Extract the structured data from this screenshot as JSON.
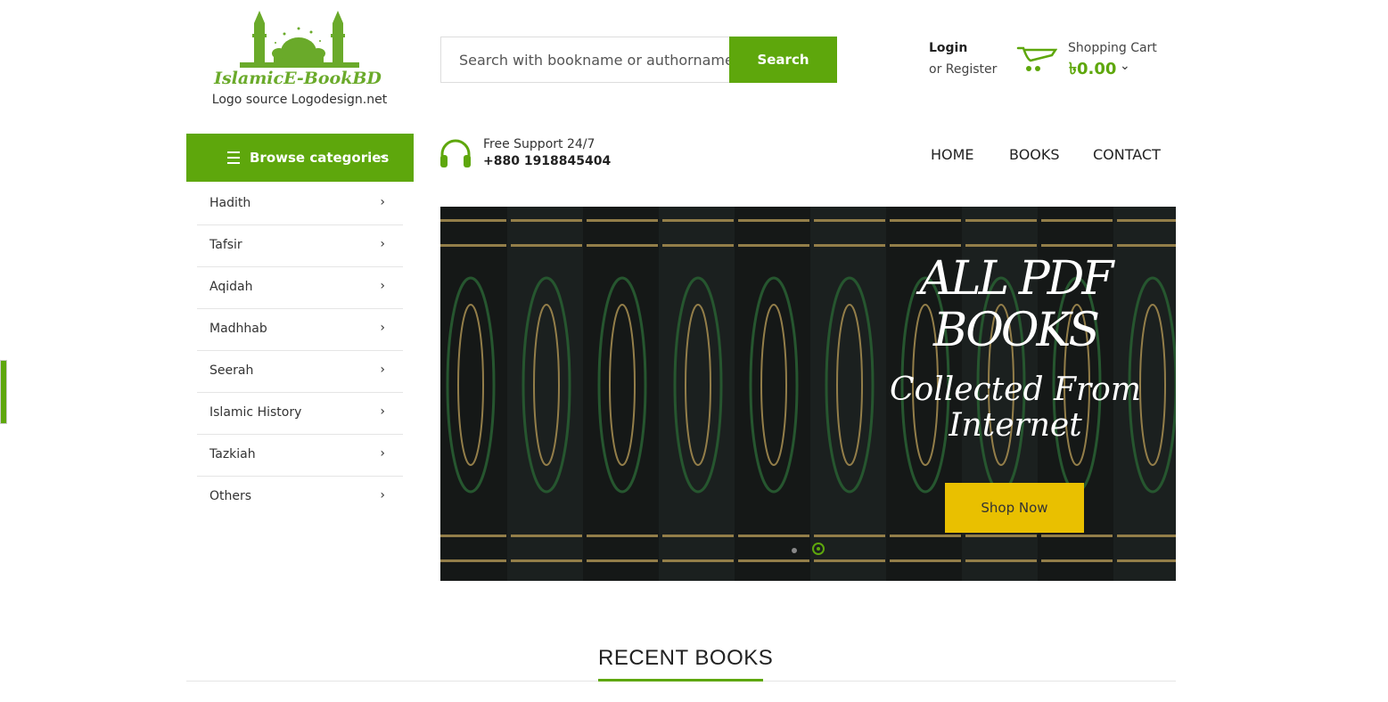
{
  "logo": {
    "text": "IslamicE-BookBD",
    "caption": "Logo source Logodesign.net"
  },
  "search": {
    "placeholder": "Search with bookname or authorname",
    "button_label": "Search"
  },
  "account": {
    "login_label": "Login",
    "register_label": "or Register"
  },
  "cart": {
    "label": "Shopping Cart",
    "total": "৳0.00"
  },
  "browse": {
    "label": "Browse categories"
  },
  "categories": [
    "Hadith",
    "Tafsir",
    "Aqidah",
    "Madhhab",
    "Seerah",
    "Islamic History",
    "Tazkiah",
    "Others"
  ],
  "support": {
    "title": "Free Support 24/7",
    "phone": "+880 1918845404"
  },
  "nav": [
    "HOME",
    "BOOKS",
    "CONTACT"
  ],
  "banner": {
    "line1": "ALL PDF",
    "line2": "BOOKS",
    "line3": "Collected From",
    "line4": "Internet",
    "button_label": "Shop Now",
    "slide_count": 2,
    "active_slide": 2
  },
  "section": {
    "recent_title": "RECENT BOOKS"
  },
  "colors": {
    "accent": "#5ea70c",
    "button_yellow": "#e9c000",
    "banner_bg": "#1c1f1e"
  }
}
